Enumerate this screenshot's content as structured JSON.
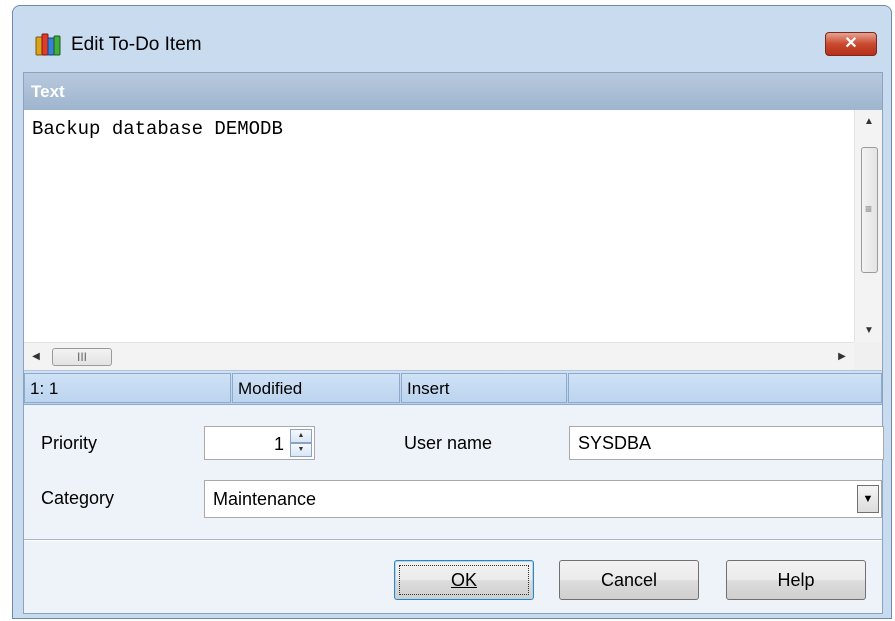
{
  "window": {
    "title": "Edit To-Do Item",
    "close_label": "✕"
  },
  "text_panel": {
    "header": "Text",
    "content": "Backup database DEMODB",
    "hscroll_grip": "III",
    "vscroll_grip": "≡"
  },
  "statusbar": {
    "position": "1:   1",
    "modified": "Modified",
    "mode": "Insert",
    "extra": ""
  },
  "form": {
    "priority_label": "Priority",
    "priority_value": "1",
    "user_name_label": "User name",
    "user_name_value": "SYSDBA",
    "category_label": "Category",
    "category_value": "Maintenance"
  },
  "buttons": {
    "ok_label": "OK",
    "cancel_label": "Cancel",
    "help_label": "Help"
  },
  "colors": {
    "frame": "#c9dcef",
    "header": "#a8bcd3",
    "statusbar": "#bcd4ef",
    "close": "#c9492f"
  }
}
